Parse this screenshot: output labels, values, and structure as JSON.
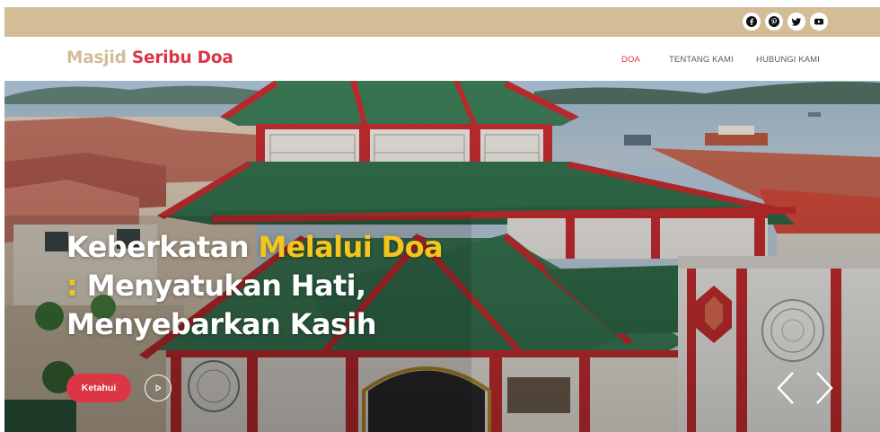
{
  "social": {
    "icons": [
      "facebook-icon",
      "pinterest-icon",
      "twitter-icon",
      "youtube-icon"
    ]
  },
  "header": {
    "brand_part1": "Masjid",
    "brand_part2": "Seribu Doa",
    "nav": [
      {
        "label": "DOA",
        "active": true
      },
      {
        "label": "TENTANG KAMI",
        "active": false
      },
      {
        "label": "HUBUNGI KAMI",
        "active": false
      }
    ]
  },
  "hero": {
    "title_part1": "Keberkatan",
    "title_highlight": "Melalui Doa",
    "title_colon": ":",
    "title_line2": "Menyatukan Hati,",
    "title_line3": "Menyebarkan Kasih",
    "cta_label": "Ketahui"
  },
  "colors": {
    "accent": "#dc3545",
    "gold": "#d3bd97",
    "highlight": "#f6c51b"
  }
}
